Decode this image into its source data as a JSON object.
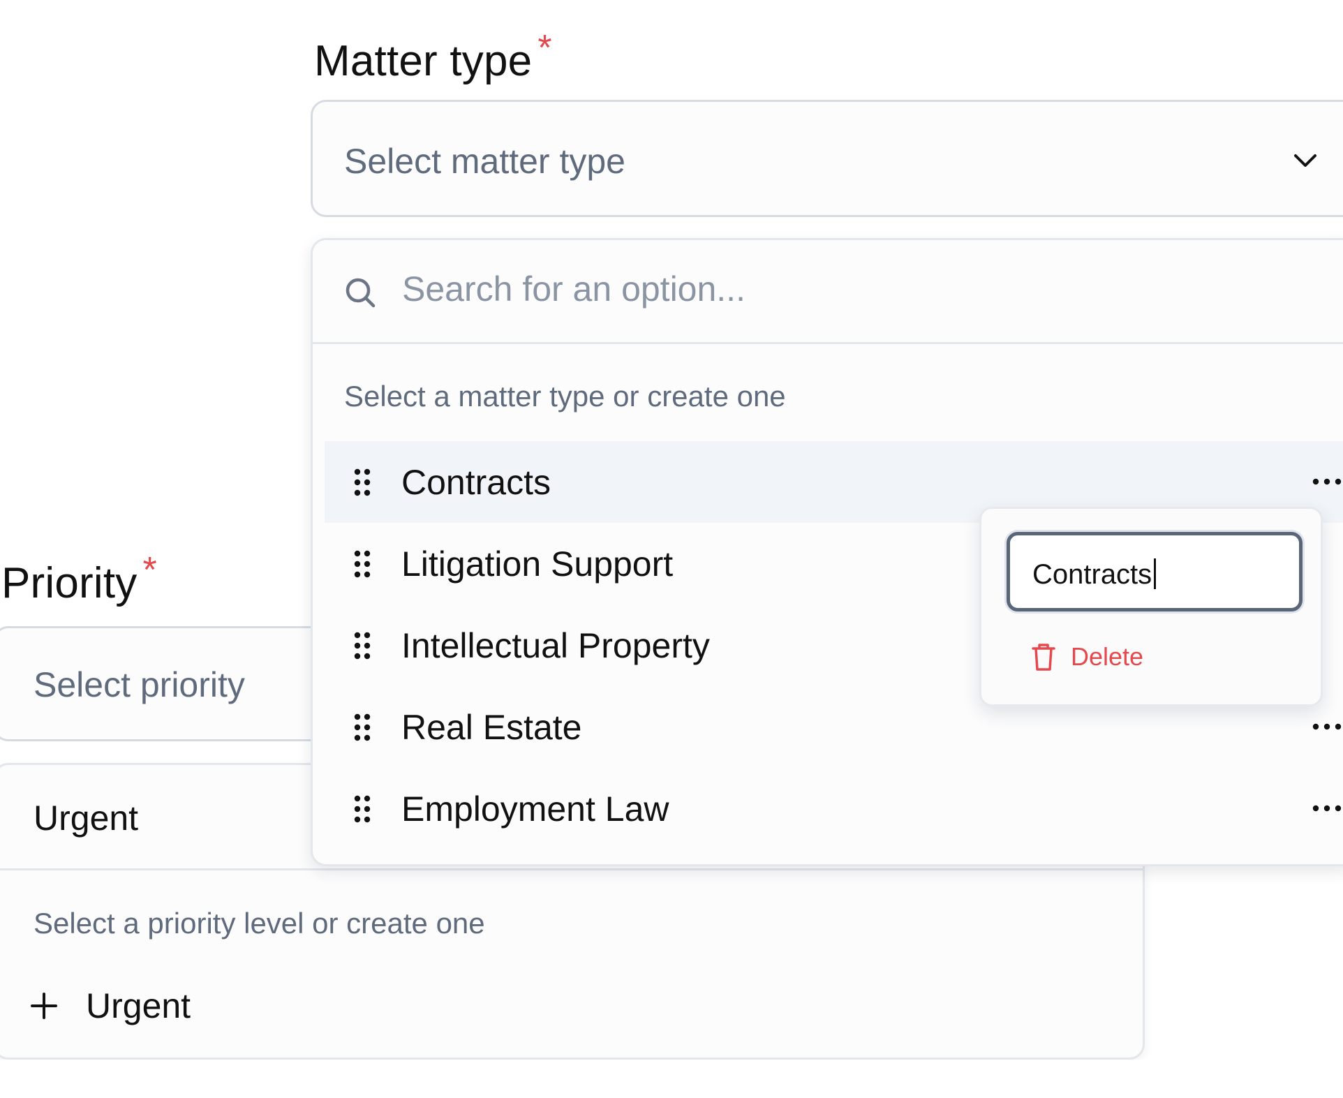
{
  "colors": {
    "required": "#e5484d",
    "danger": "#e5484d",
    "placeholder": "#5f6b7c",
    "active_row": "#f1f4f8",
    "border": "#d6dbe2"
  },
  "priority": {
    "label": "Priority",
    "required_mark": "*",
    "select_placeholder": "Select priority",
    "search_value": "Urgent",
    "hint": "Select a priority level or create one",
    "create_label": "Urgent",
    "create_icon": "plus-icon"
  },
  "matter_type": {
    "label": "Matter type",
    "required_mark": "*",
    "select_placeholder": "Select matter type",
    "select_icon": "chevron-down-icon",
    "search_placeholder": "Search for an option...",
    "search_icon": "search-icon",
    "hint": "Select a matter type or create one",
    "options": [
      {
        "label": "Contracts",
        "active": true
      },
      {
        "label": "Litigation Support"
      },
      {
        "label": "Intellectual Property"
      },
      {
        "label": "Real Estate"
      },
      {
        "label": "Employment Law"
      }
    ],
    "option_icons": [
      "drag-handle-icon",
      "more-options-icon"
    ]
  },
  "edit_popover": {
    "input_value": "Contracts",
    "delete_label": "Delete",
    "delete_icon": "trash-icon"
  }
}
